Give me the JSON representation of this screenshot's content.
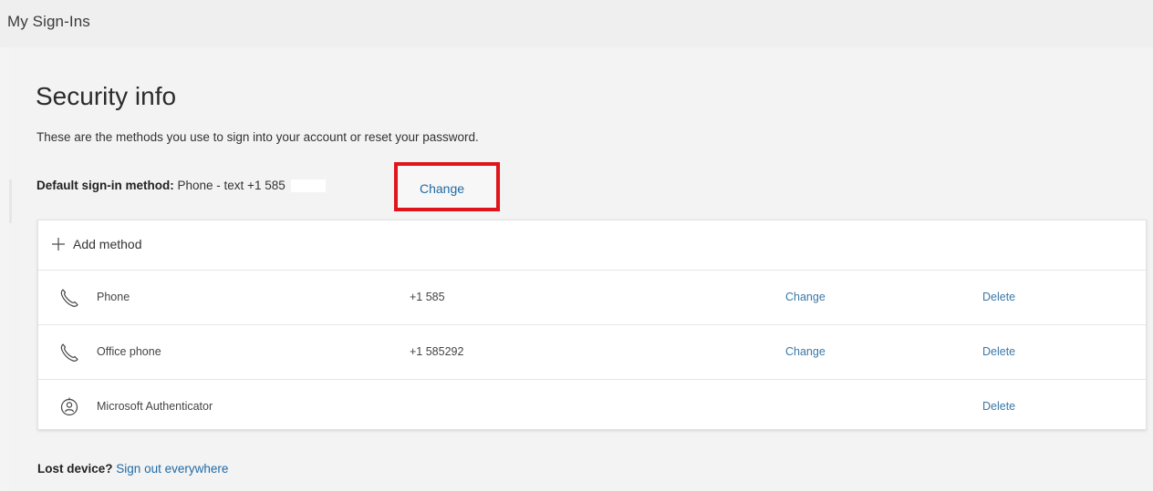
{
  "app": {
    "title": "My Sign-Ins"
  },
  "security": {
    "title": "Security info",
    "description": "These are the methods you use to sign into your account or reset your password.",
    "default_label": "Default sign-in method:",
    "default_value": "Phone - text +1 585",
    "change_label": "Change"
  },
  "methods": {
    "add_label": "Add method",
    "rows": [
      {
        "name": "Phone",
        "value": "+1 585",
        "change": "Change",
        "delete": "Delete",
        "icon": "phone-icon"
      },
      {
        "name": "Office phone",
        "value": "+1 585292",
        "change": "Change",
        "delete": "Delete",
        "icon": "phone-icon"
      },
      {
        "name": "Microsoft Authenticator",
        "value": "",
        "change": "",
        "delete": "Delete",
        "icon": "authenticator-icon"
      }
    ]
  },
  "footer": {
    "lost_label": "Lost device?",
    "signout_label": "Sign out everywhere"
  },
  "colors": {
    "accent_link": "#1f6aa5",
    "highlight_box": "#e0141b"
  }
}
